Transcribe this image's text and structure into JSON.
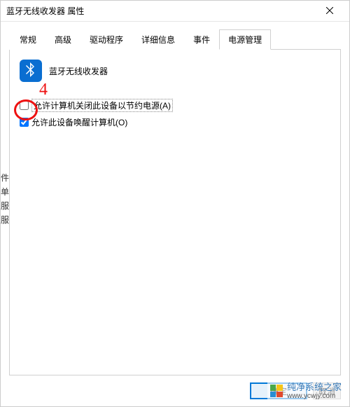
{
  "title": "蓝牙无线收发器 属性",
  "tabs": [
    "常规",
    "高级",
    "驱动程序",
    "详细信息",
    "事件",
    "电源管理"
  ],
  "active_tab_index": 5,
  "device_name": "蓝牙无线收发器",
  "checkbox1": {
    "label": "允许计算机关闭此设备以节约电源(A)",
    "checked": false
  },
  "checkbox2": {
    "label": "允许此设备唤醒计算机(O)",
    "checked": true
  },
  "annotation_number": "4",
  "buttons": {
    "ok": "确定",
    "cancel": "取消"
  },
  "left_fragment": "件\n单\n服\n服\n",
  "watermark": {
    "name": "纯净系统之家",
    "url": "www.ycwjy.com"
  }
}
